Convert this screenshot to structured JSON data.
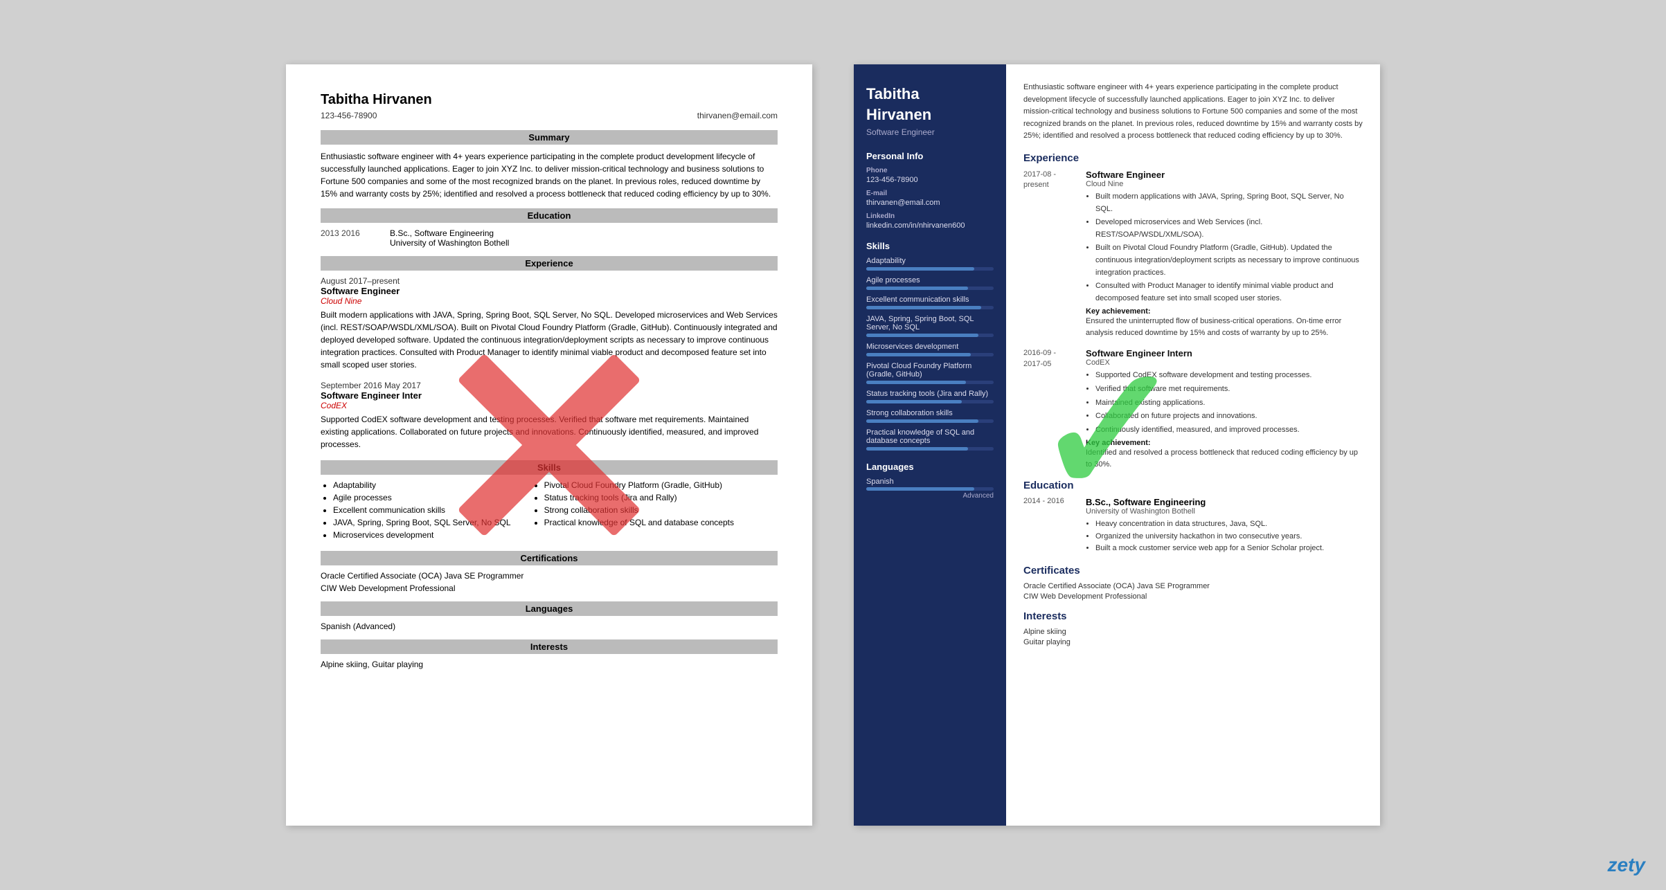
{
  "left_resume": {
    "name": "Tabitha Hirvanen",
    "phone": "123-456-78900",
    "email": "thirvanen@email.com",
    "sections": {
      "summary": {
        "title": "Summary",
        "text": "Enthusiastic software engineer with 4+ years experience participating in the complete product development lifecycle of successfully launched applications. Eager to join XYZ Inc. to deliver mission-critical technology and business solutions to Fortune 500 companies and some of the most recognized brands on the planet. In previous roles, reduced downtime by 15% and warranty costs by 25%; identified and resolved a process bottleneck that reduced coding efficiency by up to 30%."
      },
      "education": {
        "title": "Education",
        "items": [
          {
            "years": "2013  2016",
            "degree": "B.Sc., Software Engineering",
            "school": "University of Washington Bothell"
          }
        ]
      },
      "experience": {
        "title": "Experience",
        "items": [
          {
            "date": "August 2017–present",
            "title": "Software Engineer",
            "company": "Cloud Nine",
            "desc": "Built modern applications with JAVA, Spring, Spring Boot, SQL Server, No SQL. Developed microservices and Web Services (incl. REST/SOAP/WSDL/XML/SOA). Built on Pivotal Cloud Foundry Platform (Gradle, GitHub). Continuously integrated and deployed developed software. Updated the continuous integration/deployment scripts as necessary to improve continuous integration practices. Consulted with Product Manager to identify minimal viable product and decomposed feature set into small scoped user stories."
          },
          {
            "date": "September 2016  May 2017",
            "title": "Software Engineer Inter",
            "company": "CodEX",
            "desc": "Supported CodEX software development and testing processes. Verified that software met requirements. Maintained existing applications. Collaborated on future projects and innovations. Continuously identified, measured, and improved processes."
          }
        ]
      },
      "skills": {
        "title": "Skills",
        "col1": [
          "Adaptability",
          "Agile processes",
          "Excellent communication skills",
          "JAVA, Spring, Spring Boot, SQL Server, No SQL",
          "Microservices development"
        ],
        "col2": [
          "Pivotal Cloud Foundry Platform (Gradle, GitHub)",
          "Status tracking tools (Jira and Rally)",
          "Strong collaboration skills",
          "Practical knowledge of SQL and database concepts"
        ]
      },
      "certifications": {
        "title": "Certifications",
        "items": [
          "Oracle Certified Associate (OCA) Java SE Programmer",
          "CIW Web Development Professional"
        ]
      },
      "languages": {
        "title": "Languages",
        "text": "Spanish (Advanced)"
      },
      "interests": {
        "title": "Interests",
        "text": "Alpine skiing, Guitar playing"
      }
    }
  },
  "right_resume": {
    "name_line1": "Tabitha",
    "name_line2": "Hirvanen",
    "title": "Software Engineer",
    "sidebar": {
      "personal_info": {
        "title": "Personal Info",
        "phone_label": "Phone",
        "phone": "123-456-78900",
        "email_label": "E-mail",
        "email": "thirvanen@email.com",
        "linkedin_label": "LinkedIn",
        "linkedin": "linkedin.com/in/nhirvanen600"
      },
      "skills": {
        "title": "Skills",
        "items": [
          {
            "name": "Adaptability",
            "pct": 85
          },
          {
            "name": "Agile processes",
            "pct": 80
          },
          {
            "name": "Excellent communication skills",
            "pct": 90
          },
          {
            "name": "JAVA, Spring, Spring Boot, SQL Server, No SQL",
            "pct": 88
          },
          {
            "name": "Microservices development",
            "pct": 82
          },
          {
            "name": "Pivotal Cloud Foundry Platform (Gradle, GitHub)",
            "pct": 78
          },
          {
            "name": "Status tracking tools (Jira and Rally)",
            "pct": 75
          },
          {
            "name": "Strong collaboration skills",
            "pct": 88
          },
          {
            "name": "Practical knowledge of SQL and database concepts",
            "pct": 80
          }
        ]
      },
      "languages": {
        "title": "Languages",
        "items": [
          {
            "name": "Spanish",
            "pct": 85,
            "level": "Advanced"
          }
        ]
      }
    },
    "main": {
      "summary": "Enthusiastic software engineer with 4+ years experience participating in the complete product development lifecycle of successfully launched applications. Eager to join XYZ Inc. to deliver mission-critical technology and business solutions to Fortune 500 companies and some of the most recognized brands on the planet. In previous roles, reduced downtime by 15% and warranty costs by 25%; identified and resolved a process bottleneck that reduced coding efficiency by up to 30%.",
      "experience": {
        "title": "Experience",
        "items": [
          {
            "date_start": "2017-08 -",
            "date_end": "present",
            "title": "Software Engineer",
            "company": "Cloud Nine",
            "bullets": [
              "Built modern applications with JAVA, Spring, Spring Boot, SQL Server, No SQL.",
              "Developed microservices and Web Services (incl. REST/SOAP/WSDL/XML/SOA).",
              "Built on Pivotal Cloud Foundry Platform (Gradle, GitHub). Updated the continuous integration/deployment scripts as necessary to improve continuous integration practices.",
              "Consulted with Product Manager to identify minimal viable product and decomposed feature set into small scoped user stories."
            ],
            "key_achievement_label": "Key achievement:",
            "key_achievement": "Ensured the uninterrupted flow of business-critical operations. On-time error analysis reduced downtime by 15% and costs of warranty by up to 25%."
          },
          {
            "date_start": "2016-09 -",
            "date_end": "2017-05",
            "title": "Software Engineer Intern",
            "company": "CodEX",
            "bullets": [
              "Supported CodEX software development and testing processes.",
              "Verified that software met requirements.",
              "Maintained existing applications.",
              "Collaborated on future projects and innovations.",
              "Continuously identified, measured, and improved processes."
            ],
            "key_achievement_label": "Key achievement:",
            "key_achievement": "Identified and resolved a process bottleneck that reduced coding efficiency by up to 30%."
          }
        ]
      },
      "education": {
        "title": "Education",
        "items": [
          {
            "date": "2014 - 2016",
            "degree": "B.Sc., Software Engineering",
            "school": "University of Washington Bothell",
            "bullets": [
              "Heavy concentration in data structures, Java, SQL.",
              "Organized the university hackathon in two consecutive years.",
              "Built a mock customer service web app for a Senior Scholar project."
            ]
          }
        ]
      },
      "certificates": {
        "title": "Certificates",
        "items": [
          "Oracle Certified Associate (OCA) Java SE Programmer",
          "CIW Web Development Professional"
        ]
      },
      "interests": {
        "title": "Interests",
        "items": [
          "Alpine skiing",
          "Guitar playing"
        ]
      }
    }
  },
  "branding": {
    "zety": "zety"
  }
}
